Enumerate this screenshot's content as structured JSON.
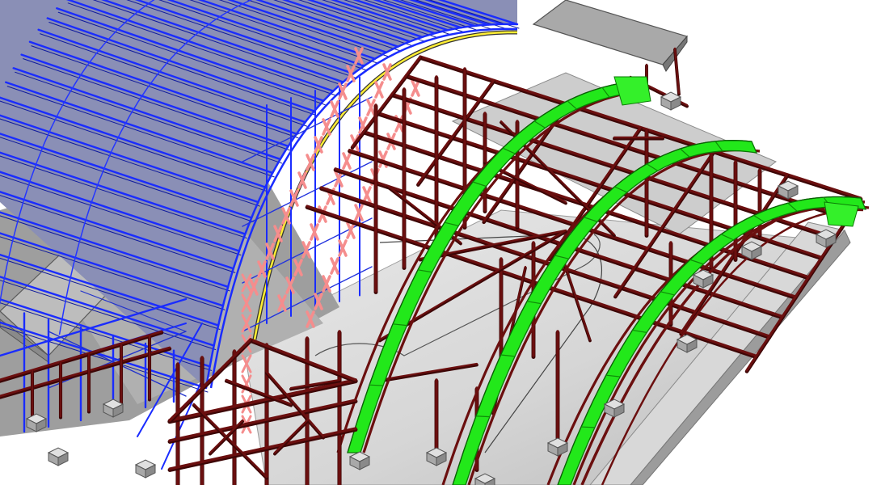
{
  "colors": {
    "background": "#ffffff",
    "slab_light": "#d6d6d6",
    "slab_mid": "#b9b9b9",
    "slab_dark": "#8d8d8d",
    "canopy": "#bdbdbd",
    "roof_blue": "#1a2cff",
    "roof_fill": "#8a8fb6",
    "steel_maroon": "#6b0f0f",
    "steel_dark": "#3d0606",
    "arch_green": "#22e81a",
    "arch_green_edge": "#0a7a05",
    "highlight_yellow": "#ffee33",
    "bracing_pink": "#f58d8d",
    "pier": "#c8c8c8",
    "pier_edge": "#555555"
  },
  "icons": {
    "view": "3d-structural-model"
  }
}
